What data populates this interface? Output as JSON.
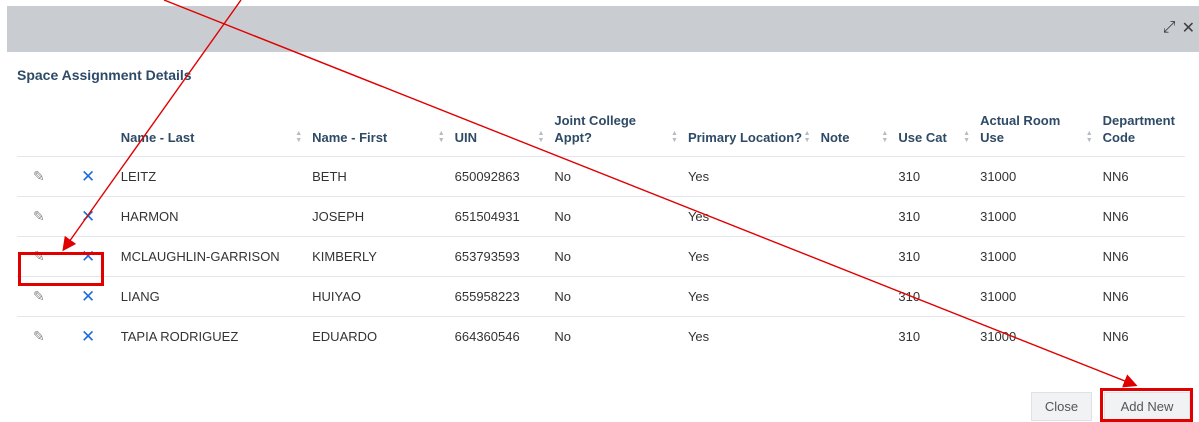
{
  "dialog": {
    "title": "Space Assignment Details",
    "expand_icon": "expand-icon",
    "close_icon": "close-icon",
    "expand_glyph": "⤢",
    "close_glyph": "✕"
  },
  "table": {
    "headers": [
      {
        "label": "",
        "sortable": false
      },
      {
        "label": "",
        "sortable": false
      },
      {
        "label": "Name - Last",
        "sortable": true
      },
      {
        "label": "Name - First",
        "sortable": true
      },
      {
        "label": "UIN",
        "sortable": true
      },
      {
        "label": "Joint College Appt?",
        "sortable": true
      },
      {
        "label": "Primary Location?",
        "sortable": true
      },
      {
        "label": "Note",
        "sortable": true
      },
      {
        "label": "Use Cat",
        "sortable": true
      },
      {
        "label": "Actual Room Use",
        "sortable": true
      },
      {
        "label": "Department Code",
        "sortable": false
      }
    ],
    "rows": [
      {
        "last": "LEITZ",
        "first": "BETH",
        "uin": "650092863",
        "joint": "No",
        "primary": "Yes",
        "note": "",
        "use_cat": "310",
        "room_use": "31000",
        "dept": "NN6"
      },
      {
        "last": "HARMON",
        "first": "JOSEPH",
        "uin": "651504931",
        "joint": "No",
        "primary": "Yes",
        "note": "",
        "use_cat": "310",
        "room_use": "31000",
        "dept": "NN6"
      },
      {
        "last": "MCLAUGHLIN-GARRISON",
        "first": "KIMBERLY",
        "uin": "653793593",
        "joint": "No",
        "primary": "Yes",
        "note": "",
        "use_cat": "310",
        "room_use": "31000",
        "dept": "NN6"
      },
      {
        "last": "LIANG",
        "first": "HUIYAO",
        "uin": "655958223",
        "joint": "No",
        "primary": "Yes",
        "note": "",
        "use_cat": "310",
        "room_use": "31000",
        "dept": "NN6"
      },
      {
        "last": "TAPIA RODRIGUEZ",
        "first": "EDUARDO",
        "uin": "664360546",
        "joint": "No",
        "primary": "Yes",
        "note": "",
        "use_cat": "310",
        "room_use": "31000",
        "dept": "NN6"
      }
    ],
    "row_icons": {
      "edit": "pencil-icon",
      "delete": "x-icon",
      "edit_glyph": "✎",
      "delete_glyph": "✕"
    }
  },
  "footer": {
    "close_label": "Close",
    "add_label": "Add New"
  },
  "annotation": {
    "color": "#e00000"
  }
}
